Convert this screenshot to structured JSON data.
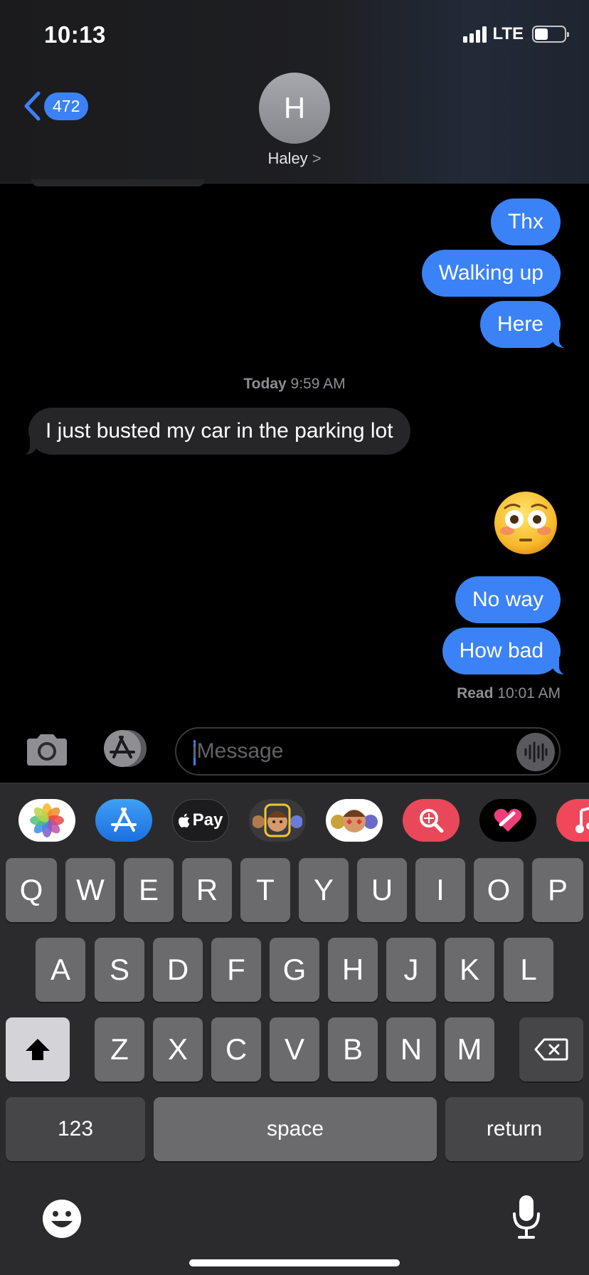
{
  "status_bar": {
    "time": "10:13",
    "network": "LTE"
  },
  "header": {
    "back_count": "472",
    "avatar_initial": "H",
    "contact_name": "Haley",
    "name_chevron": ">"
  },
  "messages": {
    "sent_1": "Thx",
    "sent_2": "Walking up",
    "sent_3": "Here",
    "timestamp_day": "Today",
    "timestamp_time": "9:59 AM",
    "received_1": "I just busted my car in the parking lot",
    "emoji_reaction": "flushed-face-emoji",
    "sent_4": "No way",
    "sent_5": "How bad",
    "read_label": "Read",
    "read_time": "10:01 AM"
  },
  "composer": {
    "placeholder": "iMessage"
  },
  "app_strip": [
    "photos-app",
    "app-store-app",
    "apple-pay-app",
    "memoji-stickers-app",
    "animoji-app",
    "image-search-app",
    "digital-touch-app",
    "music-app"
  ],
  "apple_pay_label": "Pay",
  "keyboard": {
    "row1": [
      "Q",
      "W",
      "E",
      "R",
      "T",
      "Y",
      "U",
      "I",
      "O",
      "P"
    ],
    "row2": [
      "A",
      "S",
      "D",
      "F",
      "G",
      "H",
      "J",
      "K",
      "L"
    ],
    "row3": [
      "Z",
      "X",
      "C",
      "V",
      "B",
      "N",
      "M"
    ],
    "numbers": "123",
    "space": "space",
    "return": "return"
  },
  "colors": {
    "sent_bubble": "#3b82f6",
    "received_bubble": "#262628",
    "keyboard_bg": "#2b2b2d"
  }
}
